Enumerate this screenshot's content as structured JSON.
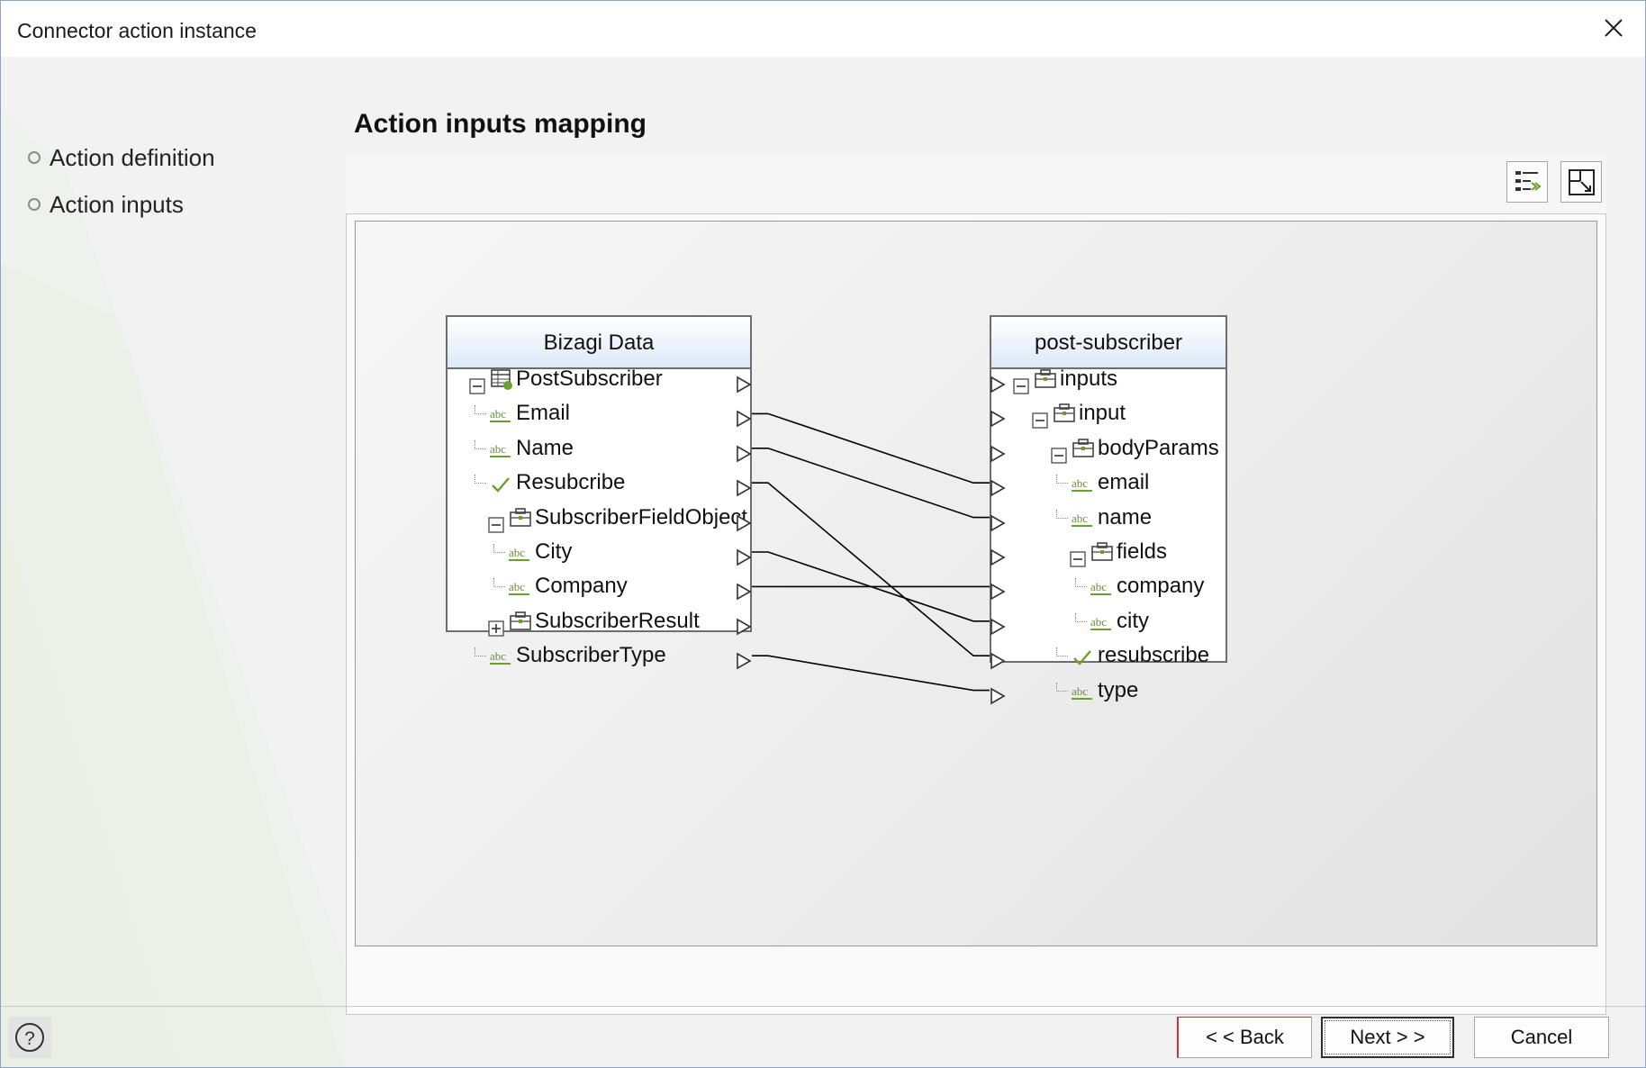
{
  "window": {
    "title": "Connector action instance"
  },
  "steps": [
    "Action definition",
    "Action inputs"
  ],
  "page_title": "Action inputs mapping",
  "source": {
    "title": "Bizagi Data",
    "rows": [
      {
        "label": "PostSubscriber",
        "icon": "entity-table-icon",
        "expander": "minus",
        "indent": 0
      },
      {
        "label": "Email",
        "icon": "abc-icon",
        "indent": 0
      },
      {
        "label": "Name",
        "icon": "abc-icon",
        "indent": 0
      },
      {
        "label": "Resubcribe",
        "icon": "check-icon",
        "indent": 0
      },
      {
        "label": "SubscriberFieldObject",
        "icon": "object-icon",
        "expander": "minus",
        "indent": 1
      },
      {
        "label": "City",
        "icon": "abc-icon",
        "indent": 1
      },
      {
        "label": "Company",
        "icon": "abc-icon",
        "indent": 1
      },
      {
        "label": "SubscriberResult",
        "icon": "object-icon",
        "expander": "plus",
        "indent": 1
      },
      {
        "label": "SubscriberType",
        "icon": "abc-icon",
        "indent": 0
      }
    ]
  },
  "target": {
    "title": "post-subscriber",
    "rows": [
      {
        "label": "inputs",
        "icon": "object-icon",
        "expander": "minus",
        "indent": 0
      },
      {
        "label": "input",
        "icon": "object-icon",
        "expander": "minus",
        "indent": 1
      },
      {
        "label": "bodyParams",
        "icon": "object-icon",
        "expander": "minus",
        "indent": 2
      },
      {
        "label": "email",
        "icon": "abc-icon",
        "indent": 2
      },
      {
        "label": "name",
        "icon": "abc-icon",
        "indent": 2
      },
      {
        "label": "fields",
        "icon": "object-icon",
        "expander": "minus",
        "indent": 3
      },
      {
        "label": "company",
        "icon": "abc-icon",
        "indent": 3
      },
      {
        "label": "city",
        "icon": "abc-icon",
        "indent": 3
      },
      {
        "label": "resubscribe",
        "icon": "check-icon",
        "indent": 2
      },
      {
        "label": "type",
        "icon": "abc-icon",
        "indent": 2
      }
    ]
  },
  "mappings": [
    {
      "from": "Email",
      "to": "email"
    },
    {
      "from": "Name",
      "to": "name"
    },
    {
      "from": "Resubcribe",
      "to": "resubscribe"
    },
    {
      "from": "City",
      "to": "city"
    },
    {
      "from": "Company",
      "to": "company"
    },
    {
      "from": "SubscriberType",
      "to": "type"
    }
  ],
  "buttons": {
    "back": "< < Back",
    "next": "Next > >",
    "cancel": "Cancel"
  },
  "colors": {
    "header_gradient_end": "#dde9f8",
    "icon_green": "#6aa12a",
    "connector": "#000000"
  }
}
